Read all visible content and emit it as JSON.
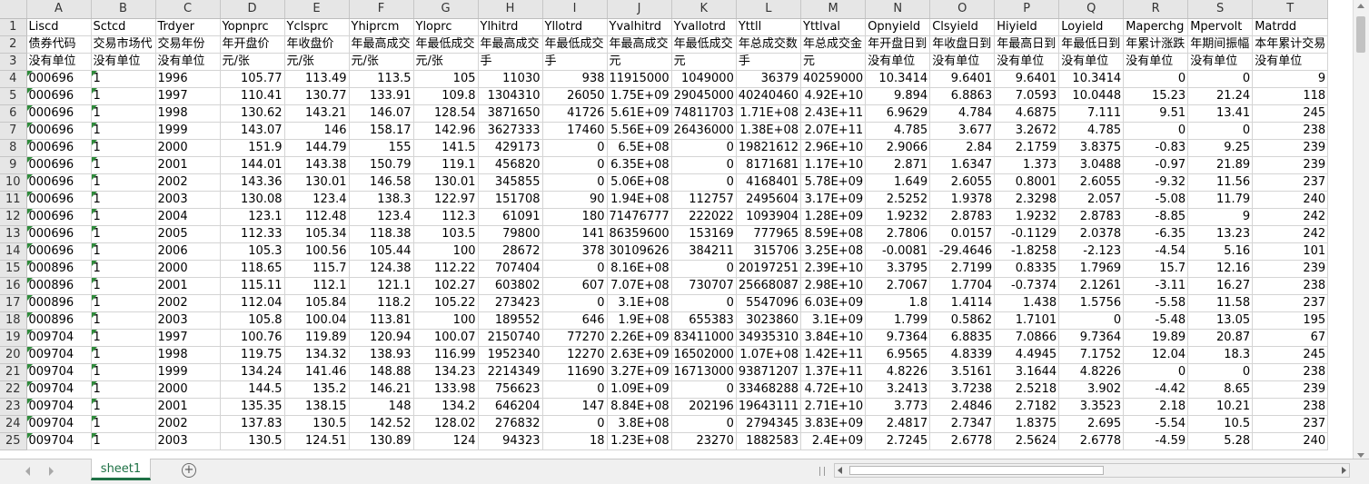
{
  "columns": [
    "A",
    "B",
    "C",
    "D",
    "E",
    "F",
    "G",
    "H",
    "I",
    "J",
    "K",
    "L",
    "M",
    "N",
    "O",
    "P",
    "Q",
    "R",
    "S",
    "T"
  ],
  "rows": [
    {
      "n": "1",
      "cells": [
        "Liscd",
        "Sctcd",
        "Trdyer",
        "Yopnprc",
        "Yclsprc",
        "Yhiprcm",
        "Yloprc",
        "Ylhitrd",
        "Yllotrd",
        "Yvalhitrd",
        "Yvallotrd",
        "Yttll",
        "Yttlval",
        "Opnyield",
        "Clsyield",
        "Hiyield",
        "Loyield",
        "Maperchg",
        "Mpervolt",
        "Matrdd"
      ]
    },
    {
      "n": "2",
      "cells": [
        "债券代码",
        "交易市场代",
        "交易年份",
        "年开盘价",
        "年收盘价",
        "年最高成交",
        "年最低成交",
        "年最高成交",
        "年最低成交",
        "年最高成交",
        "年最低成交",
        "年总成交数",
        "年总成交金",
        "年开盘日到",
        "年收盘日到",
        "年最高日到",
        "年最低日到",
        "年累计涨跌",
        "年期间振幅",
        "本年累计交易"
      ]
    },
    {
      "n": "3",
      "cells": [
        "没有单位",
        "没有单位",
        "没有单位",
        "元/张",
        "元/张",
        "元/张",
        "元/张",
        "手",
        "手",
        "元",
        "元",
        "手",
        "元",
        "没有单位",
        "没有单位",
        "没有单位",
        "没有单位",
        "没有单位",
        "没有单位",
        "没有单位"
      ]
    },
    {
      "n": "4",
      "cells": [
        "000696",
        "1",
        "1996",
        "105.77",
        "113.49",
        "113.5",
        "105",
        "11030",
        "938",
        "11915000",
        "1049000",
        "36379",
        "40259000",
        "10.3414",
        "9.6401",
        "9.6401",
        "10.3414",
        "0",
        "0",
        "9"
      ]
    },
    {
      "n": "5",
      "cells": [
        "000696",
        "1",
        "1997",
        "110.41",
        "130.77",
        "133.91",
        "109.8",
        "1304310",
        "26050",
        "1.75E+09",
        "29045000",
        "40240460",
        "4.92E+10",
        "9.894",
        "6.8863",
        "7.0593",
        "10.0448",
        "15.23",
        "21.24",
        "118"
      ]
    },
    {
      "n": "6",
      "cells": [
        "000696",
        "1",
        "1998",
        "130.62",
        "143.21",
        "146.07",
        "128.54",
        "3871650",
        "41726",
        "5.61E+09",
        "74811703",
        "1.71E+08",
        "2.43E+11",
        "6.9629",
        "4.784",
        "4.6875",
        "7.111",
        "9.51",
        "13.41",
        "245"
      ]
    },
    {
      "n": "7",
      "cells": [
        "000696",
        "1",
        "1999",
        "143.07",
        "146",
        "158.17",
        "142.96",
        "3627333",
        "17460",
        "5.56E+09",
        "26436000",
        "1.38E+08",
        "2.07E+11",
        "4.785",
        "3.677",
        "3.2672",
        "4.785",
        "0",
        "0",
        "238"
      ]
    },
    {
      "n": "8",
      "cells": [
        "000696",
        "1",
        "2000",
        "151.9",
        "144.79",
        "155",
        "141.5",
        "429173",
        "0",
        "6.5E+08",
        "0",
        "19821612",
        "2.96E+10",
        "2.9066",
        "2.84",
        "2.1759",
        "3.8375",
        "-0.83",
        "9.25",
        "239"
      ]
    },
    {
      "n": "9",
      "cells": [
        "000696",
        "1",
        "2001",
        "144.01",
        "143.38",
        "150.79",
        "119.1",
        "456820",
        "0",
        "6.35E+08",
        "0",
        "8171681",
        "1.17E+10",
        "2.871",
        "1.6347",
        "1.373",
        "3.0488",
        "-0.97",
        "21.89",
        "239"
      ]
    },
    {
      "n": "10",
      "cells": [
        "000696",
        "1",
        "2002",
        "143.36",
        "130.01",
        "146.58",
        "130.01",
        "345855",
        "0",
        "5.06E+08",
        "0",
        "4168401",
        "5.78E+09",
        "1.649",
        "2.6055",
        "0.8001",
        "2.6055",
        "-9.32",
        "11.56",
        "237"
      ]
    },
    {
      "n": "11",
      "cells": [
        "000696",
        "1",
        "2003",
        "130.08",
        "123.4",
        "138.3",
        "122.97",
        "151708",
        "90",
        "1.94E+08",
        "112757",
        "2495604",
        "3.17E+09",
        "2.5252",
        "1.9378",
        "2.3298",
        "2.057",
        "-5.08",
        "11.79",
        "240"
      ]
    },
    {
      "n": "12",
      "cells": [
        "000696",
        "1",
        "2004",
        "123.1",
        "112.48",
        "123.4",
        "112.3",
        "61091",
        "180",
        "71476777",
        "222022",
        "1093904",
        "1.28E+09",
        "1.9232",
        "2.8783",
        "1.9232",
        "2.8783",
        "-8.85",
        "9",
        "242"
      ]
    },
    {
      "n": "13",
      "cells": [
        "000696",
        "1",
        "2005",
        "112.33",
        "105.34",
        "118.38",
        "103.5",
        "79800",
        "141",
        "86359600",
        "153169",
        "777965",
        "8.59E+08",
        "2.7806",
        "0.0157",
        "-0.1129",
        "2.0378",
        "-6.35",
        "13.23",
        "242"
      ]
    },
    {
      "n": "14",
      "cells": [
        "000696",
        "1",
        "2006",
        "105.3",
        "100.56",
        "105.44",
        "100",
        "28672",
        "378",
        "30109626",
        "384211",
        "315706",
        "3.25E+08",
        "-0.0081",
        "-29.4646",
        "-1.8258",
        "-2.123",
        "-4.54",
        "5.16",
        "101"
      ]
    },
    {
      "n": "15",
      "cells": [
        "000896",
        "1",
        "2000",
        "118.65",
        "115.7",
        "124.38",
        "112.22",
        "707404",
        "0",
        "8.16E+08",
        "0",
        "20197251",
        "2.39E+10",
        "3.3795",
        "2.7199",
        "0.8335",
        "1.7969",
        "15.7",
        "12.16",
        "239"
      ]
    },
    {
      "n": "16",
      "cells": [
        "000896",
        "1",
        "2001",
        "115.11",
        "112.1",
        "121.1",
        "102.27",
        "603802",
        "607",
        "7.07E+08",
        "730707",
        "25668087",
        "2.98E+10",
        "2.7067",
        "1.7704",
        "-0.7374",
        "2.1261",
        "-3.11",
        "16.27",
        "238"
      ]
    },
    {
      "n": "17",
      "cells": [
        "000896",
        "1",
        "2002",
        "112.04",
        "105.84",
        "118.2",
        "105.22",
        "273423",
        "0",
        "3.1E+08",
        "0",
        "5547096",
        "6.03E+09",
        "1.8",
        "1.4114",
        "1.438",
        "1.5756",
        "-5.58",
        "11.58",
        "237"
      ]
    },
    {
      "n": "18",
      "cells": [
        "000896",
        "1",
        "2003",
        "105.8",
        "100.04",
        "113.81",
        "100",
        "189552",
        "646",
        "1.9E+08",
        "655383",
        "3023860",
        "3.1E+09",
        "1.799",
        "0.5862",
        "1.7101",
        "0",
        "-5.48",
        "13.05",
        "195"
      ]
    },
    {
      "n": "19",
      "cells": [
        "009704",
        "1",
        "1997",
        "100.76",
        "119.89",
        "120.94",
        "100.07",
        "2150740",
        "77270",
        "2.26E+09",
        "83411000",
        "34935310",
        "3.84E+10",
        "9.7364",
        "6.8835",
        "7.0866",
        "9.7364",
        "19.89",
        "20.87",
        "67"
      ]
    },
    {
      "n": "20",
      "cells": [
        "009704",
        "1",
        "1998",
        "119.75",
        "134.32",
        "138.93",
        "116.99",
        "1952340",
        "12270",
        "2.63E+09",
        "16502000",
        "1.07E+08",
        "1.42E+11",
        "6.9565",
        "4.8339",
        "4.4945",
        "7.1752",
        "12.04",
        "18.3",
        "245"
      ]
    },
    {
      "n": "21",
      "cells": [
        "009704",
        "1",
        "1999",
        "134.24",
        "141.46",
        "148.88",
        "134.23",
        "2214349",
        "11690",
        "3.27E+09",
        "16713000",
        "93871207",
        "1.37E+11",
        "4.8226",
        "3.5161",
        "3.1644",
        "4.8226",
        "0",
        "0",
        "238"
      ]
    },
    {
      "n": "22",
      "cells": [
        "009704",
        "1",
        "2000",
        "144.5",
        "135.2",
        "146.21",
        "133.98",
        "756623",
        "0",
        "1.09E+09",
        "0",
        "33468288",
        "4.72E+10",
        "3.2413",
        "3.7238",
        "2.5218",
        "3.902",
        "-4.42",
        "8.65",
        "239"
      ]
    },
    {
      "n": "23",
      "cells": [
        "009704",
        "1",
        "2001",
        "135.35",
        "138.15",
        "148",
        "134.2",
        "646204",
        "147",
        "8.84E+08",
        "202196",
        "19643111",
        "2.71E+10",
        "3.773",
        "2.4846",
        "2.7182",
        "3.3523",
        "2.18",
        "10.21",
        "238"
      ]
    },
    {
      "n": "24",
      "cells": [
        "009704",
        "1",
        "2002",
        "137.83",
        "130.5",
        "142.52",
        "128.02",
        "276832",
        "0",
        "3.8E+08",
        "0",
        "2794345",
        "3.83E+09",
        "2.4817",
        "2.7347",
        "1.8375",
        "2.695",
        "-5.54",
        "10.5",
        "237"
      ]
    },
    {
      "n": "25",
      "cells": [
        "009704",
        "1",
        "2003",
        "130.5",
        "124.51",
        "130.89",
        "124",
        "94323",
        "18",
        "1.23E+08",
        "23270",
        "1882583",
        "2.4E+09",
        "2.7245",
        "2.6778",
        "2.5624",
        "2.6778",
        "-4.59",
        "5.28",
        "240"
      ]
    }
  ],
  "textCols": [
    0,
    1,
    2
  ],
  "triangleCols": [
    0,
    1
  ],
  "sheet": {
    "tab_label": "sheet1",
    "add_label": "+"
  }
}
